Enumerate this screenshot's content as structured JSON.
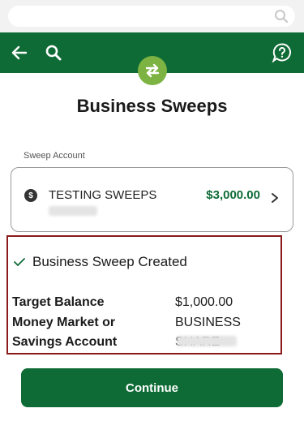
{
  "appbar": {
    "bg": "#0f6b36",
    "badge_color": "#7cb342"
  },
  "page": {
    "title": "Business Sweeps"
  },
  "sweep_account": {
    "label": "Sweep Account",
    "name": "TESTING SWEEPS",
    "amount": "$3,000.00",
    "currency_symbol": "$"
  },
  "result": {
    "title": "Business Sweep Created",
    "target_label": "Target Balance",
    "target_value": "$1,000.00",
    "account_label_line1": "Money Market or",
    "account_label_line2": "Savings Account",
    "account_value": "BUSINESS SHARE",
    "border_color": "#8b1a1a"
  },
  "actions": {
    "continue_label": "Continue"
  }
}
